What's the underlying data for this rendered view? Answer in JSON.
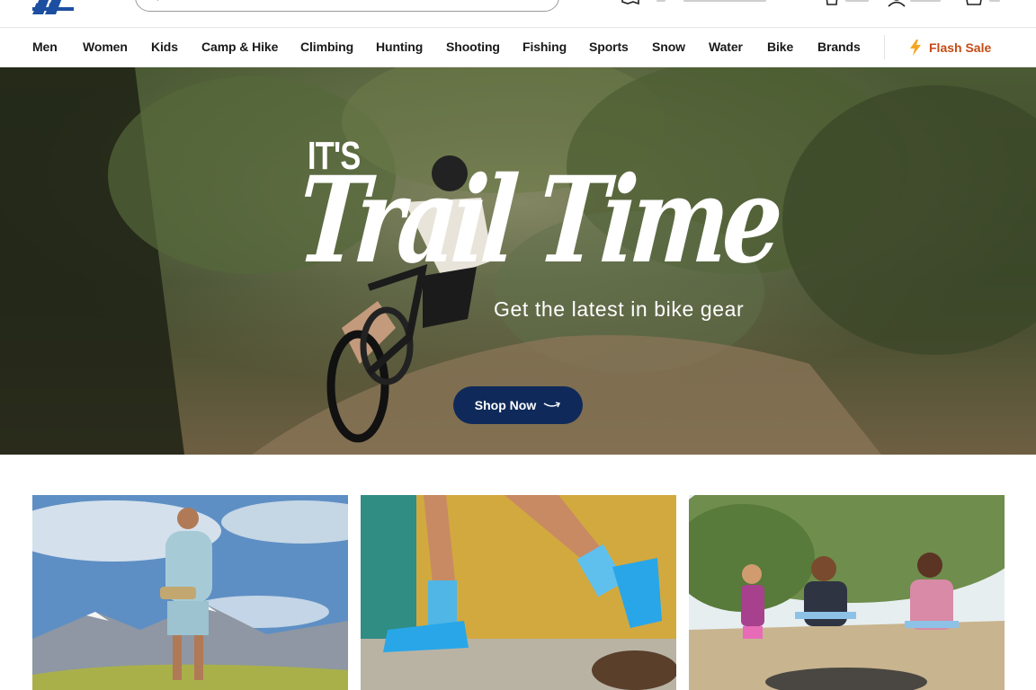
{
  "header": {
    "logo_text": "AL'S",
    "search_icon": "search-icon",
    "utility_icons": [
      "map-pin-icon",
      "store-icon",
      "account-icon",
      "cart-icon"
    ]
  },
  "nav": {
    "items": [
      "Men",
      "Women",
      "Kids",
      "Camp & Hike",
      "Climbing",
      "Hunting",
      "Shooting",
      "Fishing",
      "Sports",
      "Snow",
      "Water",
      "Bike",
      "Brands"
    ],
    "flash_sale": {
      "label": "Flash Sale",
      "icon": "lightning-bolt-icon",
      "color": "#c44b13"
    }
  },
  "hero": {
    "eyebrow": "IT'S",
    "title": "Trail Time",
    "subtitle": "Get the latest in bike gear",
    "cta_label": "Shop Now",
    "cta_icon": "arrow-right-icon",
    "cta_color": "#0f2a5a"
  },
  "tiles": [
    {
      "name": "hiking-tile",
      "scene": "woman hiker on mountain"
    },
    {
      "name": "running-shoes-tile",
      "scene": "runner in blue shoes"
    },
    {
      "name": "camping-tile",
      "scene": "family at campfire"
    }
  ],
  "colors": {
    "brand_blue": "#1d4fa0",
    "accent_orange": "#c44b13",
    "navy": "#0f2a5a"
  }
}
